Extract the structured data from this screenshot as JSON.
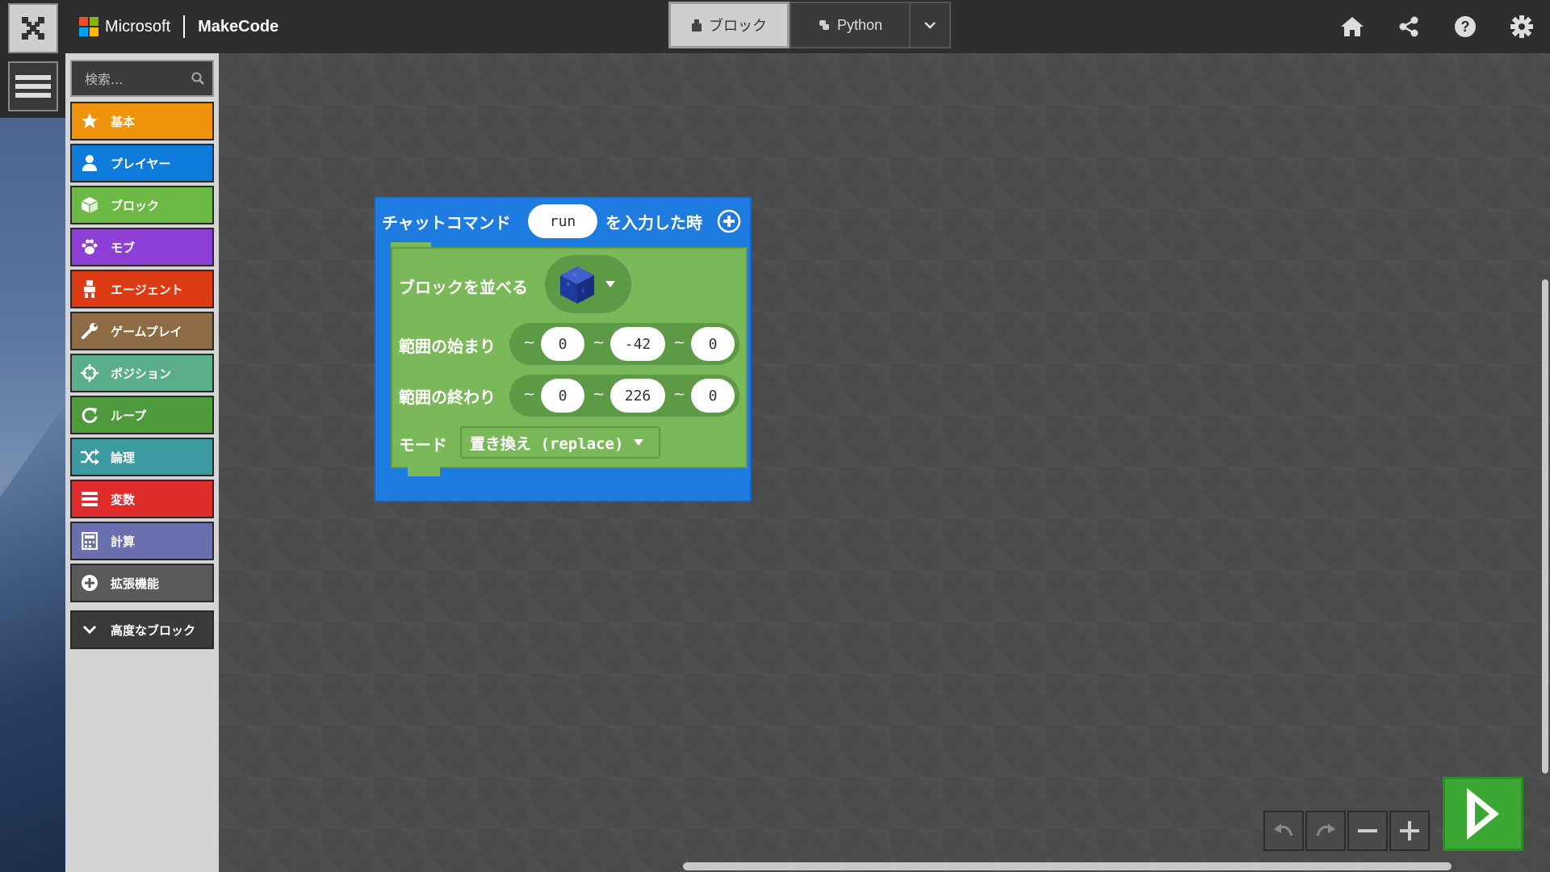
{
  "header": {
    "brand_ms": "Microsoft",
    "brand_app": "MakeCode",
    "toggle_blocks": "ブロック",
    "toggle_python": "Python"
  },
  "toolbox": {
    "search_placeholder": "検索...",
    "categories": [
      {
        "label": "基本",
        "color": "#f0930c",
        "icon": "star-icon"
      },
      {
        "label": "プレイヤー",
        "color": "#0f7bdc",
        "icon": "person-icon"
      },
      {
        "label": "ブロック",
        "color": "#6cba45",
        "icon": "cube-icon"
      },
      {
        "label": "モブ",
        "color": "#8e3fd6",
        "icon": "paw-icon"
      },
      {
        "label": "エージェント",
        "color": "#dc3b14",
        "icon": "agent-icon"
      },
      {
        "label": "ゲームプレイ",
        "color": "#8d6b45",
        "icon": "wrench-icon"
      },
      {
        "label": "ポジション",
        "color": "#5aae8a",
        "icon": "crosshair-icon"
      },
      {
        "label": "ループ",
        "color": "#4f9a3c",
        "icon": "loop-icon"
      },
      {
        "label": "論理",
        "color": "#3c9aa2",
        "icon": "shuffle-icon"
      },
      {
        "label": "変数",
        "color": "#e12c2c",
        "icon": "list-icon"
      },
      {
        "label": "計算",
        "color": "#6a6fb0",
        "icon": "calculator-icon"
      },
      {
        "label": "拡張機能",
        "color": "#5a5a5a",
        "icon": "plus-circle-icon"
      }
    ],
    "advanced_label": "高度なブロック"
  },
  "workspace": {
    "event_label": "チャットコマンド",
    "command_value": "run",
    "event_suffix": "を入力した時",
    "fill_label": "ブロックを並べる",
    "from_label": "範囲の始まり",
    "from_x": "0",
    "from_y": "-42",
    "from_z": "0",
    "to_label": "範囲の終わり",
    "to_x": "0",
    "to_y": "226",
    "to_z": "0",
    "tilde": "~",
    "mode_label": "モード",
    "mode_value": "置き換え (replace)"
  }
}
